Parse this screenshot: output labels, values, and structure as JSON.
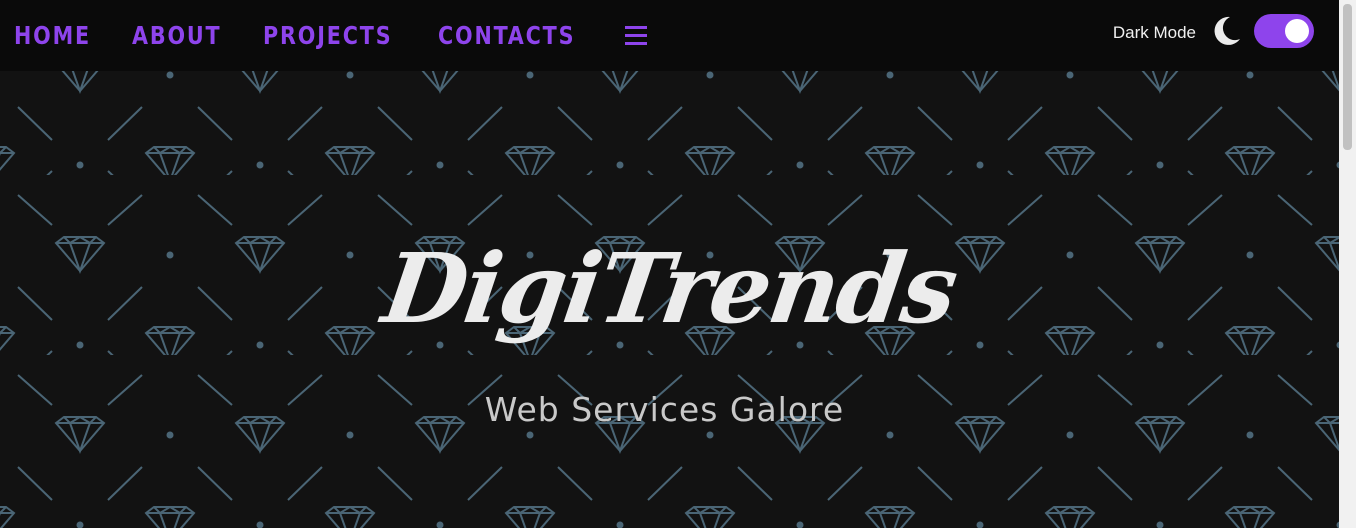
{
  "nav": {
    "links": [
      "HOME",
      "ABOUT",
      "PROJECTS",
      "CONTACTS"
    ],
    "menu_icon": "hamburger-icon",
    "dark_mode_label": "Dark Mode",
    "dark_mode_icon": "moon-icon",
    "dark_mode_enabled": true
  },
  "hero": {
    "title": "DigiTrends",
    "subtitle": "Web Services Galore"
  },
  "colors": {
    "accent": "#8e44ec",
    "background": "#121212",
    "navbar": "#0a0a0a",
    "pattern": "#4a6575"
  },
  "background_pattern": "diamond-pattern"
}
